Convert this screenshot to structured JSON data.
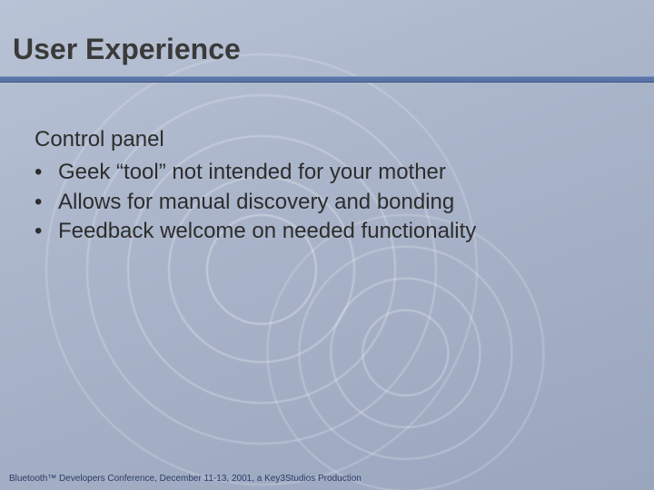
{
  "title": "User Experience",
  "intro": "Control panel",
  "bullets": [
    "Geek “tool” not intended for your mother",
    "Allows for manual discovery and bonding",
    "Feedback welcome on needed functionality"
  ],
  "footer": "Bluetooth™ Developers Conference, December 11-13, 2001, a Key3Studios Production"
}
